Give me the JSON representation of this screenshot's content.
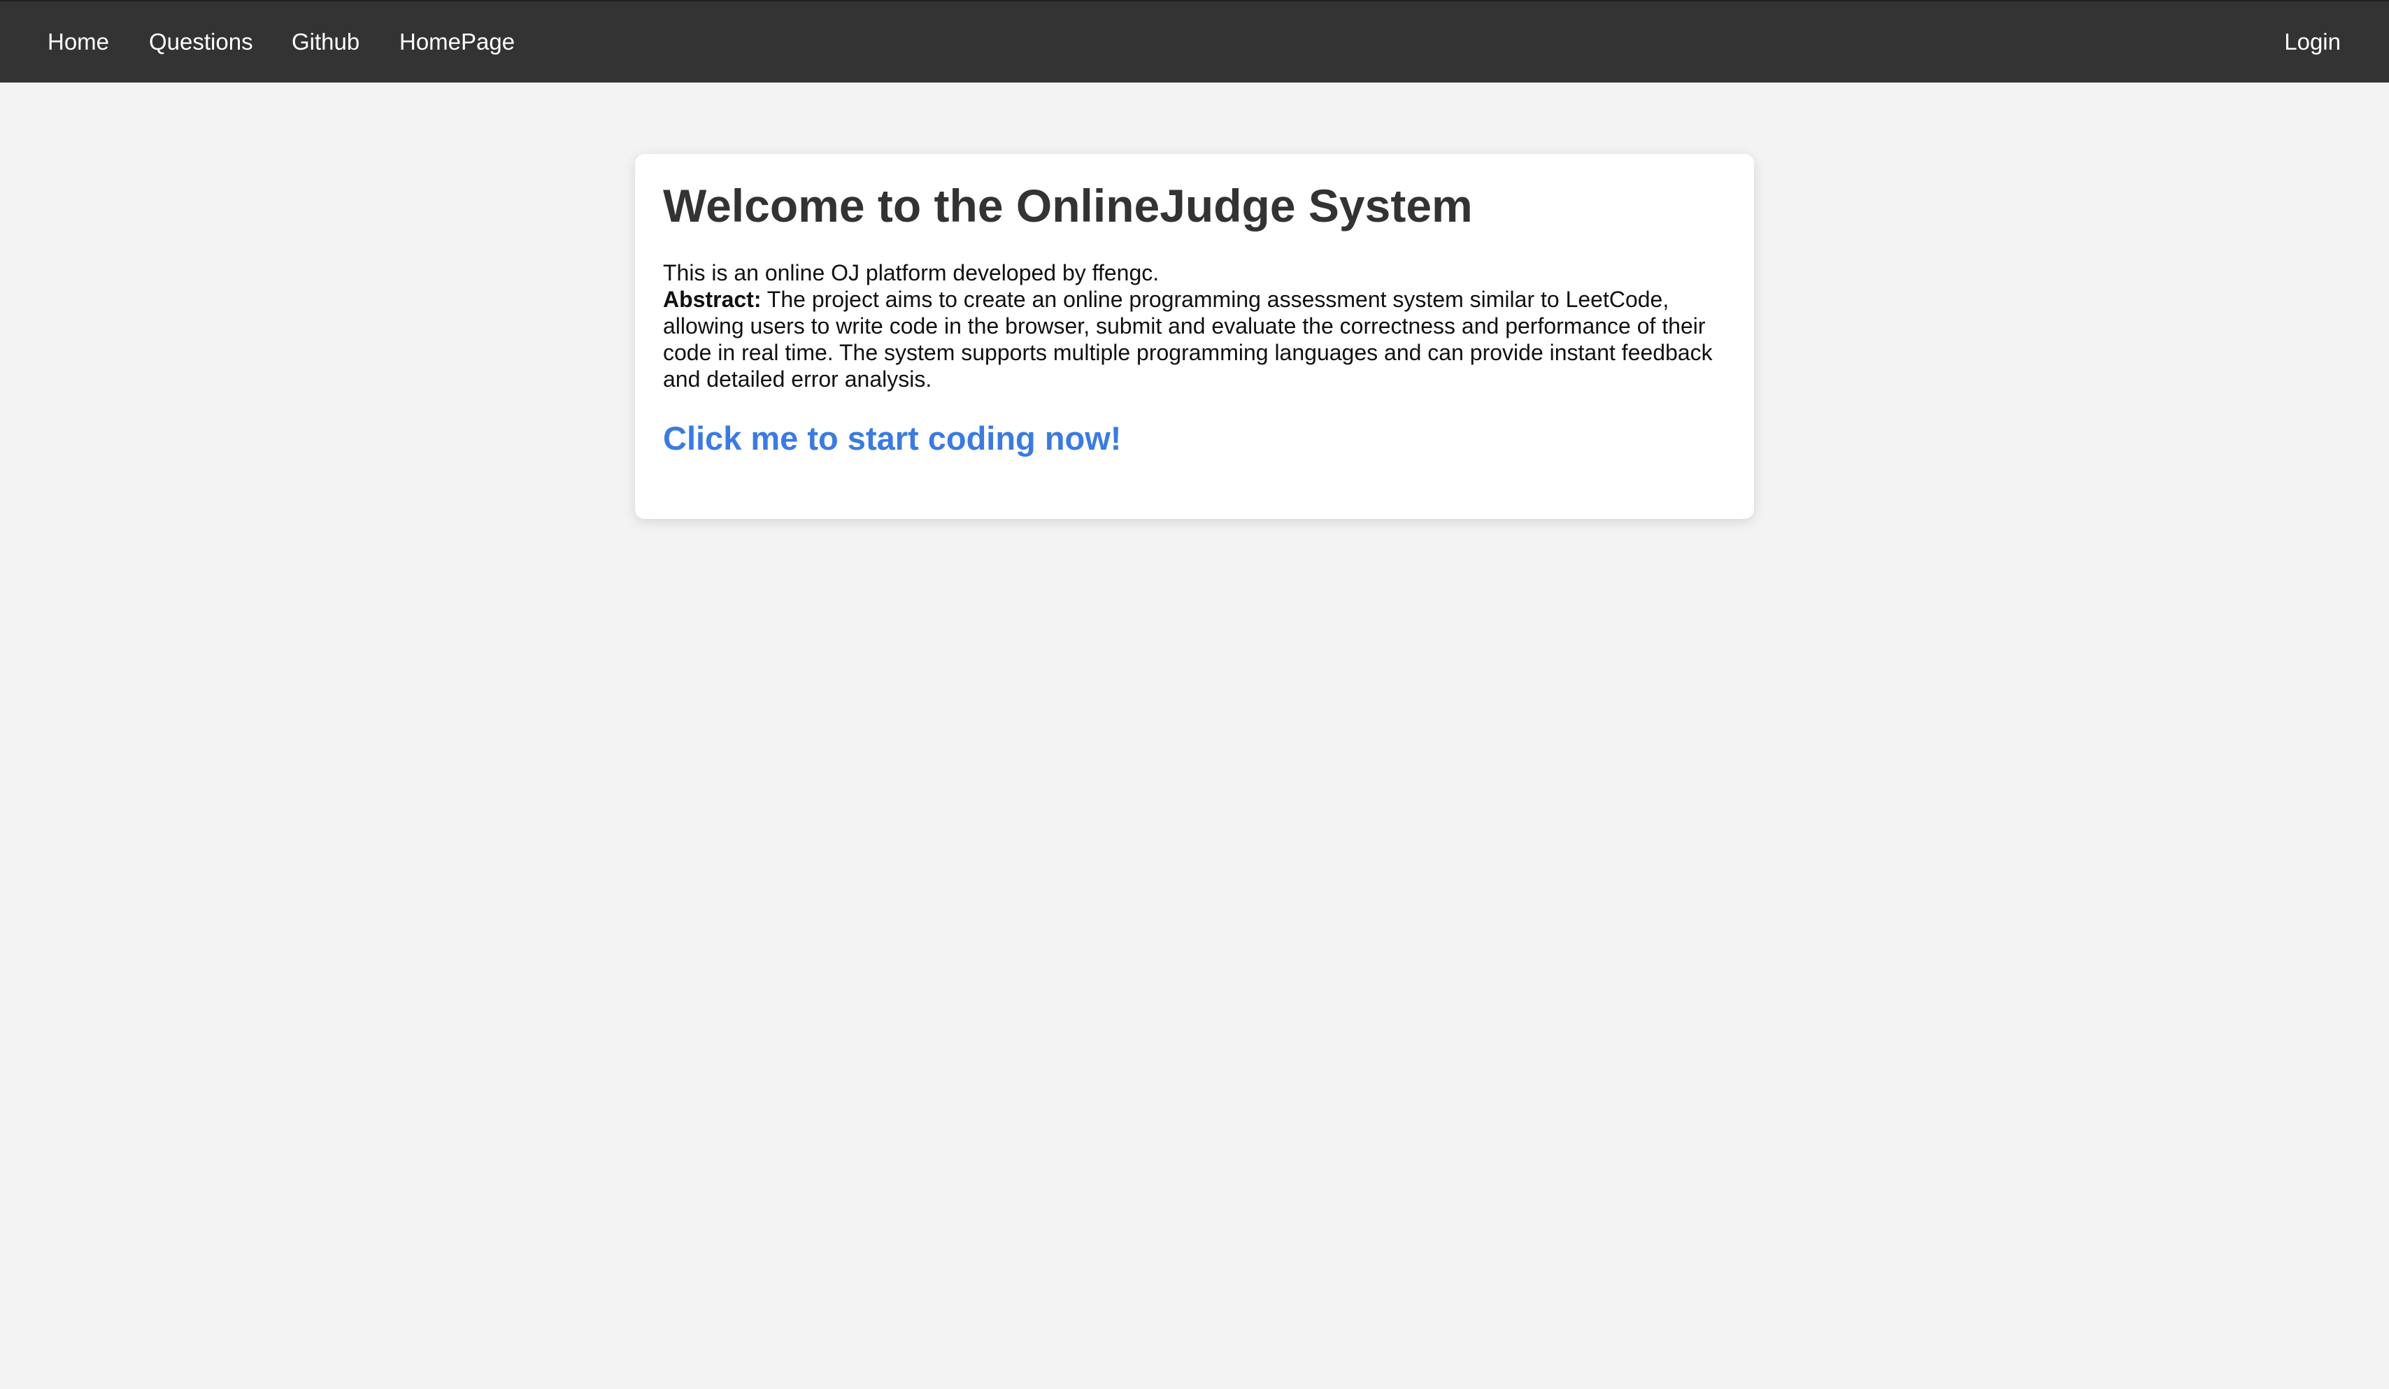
{
  "nav": {
    "items": [
      {
        "label": "Home"
      },
      {
        "label": "Questions"
      },
      {
        "label": "Github"
      },
      {
        "label": "HomePage"
      }
    ],
    "login_label": "Login"
  },
  "welcome": {
    "title": "Welcome to the OnlineJudge System",
    "intro": "This is an online OJ platform developed by ffengc.",
    "abstract_label": "Abstract:",
    "abstract_text": " The project aims to create an online programming assessment system similar to LeetCode, allowing users to write code in the browser, submit and evaluate the correctness and performance of their code in real time. The system supports multiple programming languages and can provide instant feedback and detailed error analysis.",
    "cta_label": "Click me to start coding now!"
  },
  "colors": {
    "topbar_bg": "#333333",
    "page_bg": "#f3f3f3",
    "card_bg": "#ffffff",
    "cta_link": "#3b7be0",
    "title_text": "#333333"
  }
}
